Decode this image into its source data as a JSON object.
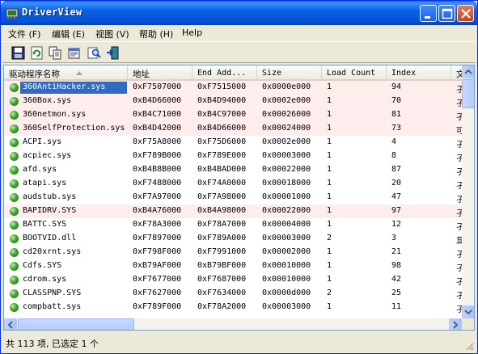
{
  "window": {
    "title": "DriverView"
  },
  "menu": [
    "文件 (F)",
    "编辑 (E)",
    "视图 (V)",
    "帮助 (H)",
    "Help"
  ],
  "toolbar": [
    "save-icon",
    "refresh-icon",
    "copy-icon",
    "properties-icon",
    "search-icon",
    "exit-icon"
  ],
  "columns": [
    "驱动程序名称",
    "地址",
    "End Add...",
    "Size",
    "Load Count",
    "Index",
    "文"
  ],
  "rows": [
    {
      "name": "360AntiHacker.sys",
      "addr": "0xF7507000",
      "end": "0xF7515000",
      "size": "0x0000e000",
      "count": "1",
      "index": "94",
      "extra": "孑",
      "pink": true,
      "selected": true
    },
    {
      "name": "360Box.sys",
      "addr": "0xB4D66000",
      "end": "0xB4D94000",
      "size": "0x0002e000",
      "count": "1",
      "index": "70",
      "extra": "孑",
      "pink": true
    },
    {
      "name": "360netmon.sys",
      "addr": "0xB4C71000",
      "end": "0xB4C97000",
      "size": "0x00026000",
      "count": "1",
      "index": "81",
      "extra": "孑",
      "pink": true
    },
    {
      "name": "360SelfProtection.sys",
      "addr": "0xB4D42000",
      "end": "0xB4D66000",
      "size": "0x00024000",
      "count": "1",
      "index": "73",
      "extra": "可",
      "pink": true
    },
    {
      "name": "ACPI.sys",
      "addr": "0xF75A8000",
      "end": "0xF75D6000",
      "size": "0x0002e000",
      "count": "1",
      "index": "4",
      "extra": "孑"
    },
    {
      "name": "acpiec.sys",
      "addr": "0xF789B000",
      "end": "0xF789E000",
      "size": "0x00003000",
      "count": "1",
      "index": "8",
      "extra": "孑"
    },
    {
      "name": "afd.sys",
      "addr": "0xB4B8B000",
      "end": "0xB4BAD000",
      "size": "0x00022000",
      "count": "1",
      "index": "87",
      "extra": "孑"
    },
    {
      "name": "atapi.sys",
      "addr": "0xF7488000",
      "end": "0xF74A0000",
      "size": "0x00018000",
      "count": "1",
      "index": "20",
      "extra": "孑"
    },
    {
      "name": "audstub.sys",
      "addr": "0xF7A97000",
      "end": "0xF7A98000",
      "size": "0x00001000",
      "count": "1",
      "index": "47",
      "extra": "孑"
    },
    {
      "name": "BAPIDRV.SYS",
      "addr": "0xB4A76000",
      "end": "0xB4A98000",
      "size": "0x00022000",
      "count": "1",
      "index": "97",
      "extra": "孑",
      "pink": true
    },
    {
      "name": "BATTC.SYS",
      "addr": "0xF78A3000",
      "end": "0xF78A7000",
      "size": "0x00004000",
      "count": "1",
      "index": "12",
      "extra": "孑"
    },
    {
      "name": "BOOTVID.dll",
      "addr": "0xF7897000",
      "end": "0xF789A000",
      "size": "0x00003000",
      "count": "2",
      "index": "3",
      "extra": "显"
    },
    {
      "name": "cd20xrnt.sys",
      "addr": "0xF798F000",
      "end": "0xF7991000",
      "size": "0x00002000",
      "count": "1",
      "index": "21",
      "extra": "孑"
    },
    {
      "name": "Cdfs.SYS",
      "addr": "0xB79AF000",
      "end": "0xB79BF000",
      "size": "0x00010000",
      "count": "1",
      "index": "98",
      "extra": "孑"
    },
    {
      "name": "cdrom.sys",
      "addr": "0xF7677000",
      "end": "0xF7687000",
      "size": "0x00010000",
      "count": "1",
      "index": "42",
      "extra": "孑"
    },
    {
      "name": "CLASSPNP.SYS",
      "addr": "0xF7627000",
      "end": "0xF7634000",
      "size": "0x0000d000",
      "count": "2",
      "index": "25",
      "extra": "孑"
    },
    {
      "name": "compbatt.sys",
      "addr": "0xF789F000",
      "end": "0xF78A2000",
      "size": "0x00003000",
      "count": "1",
      "index": "11",
      "extra": "孑"
    }
  ],
  "status": "共 113 项, 已选定 1 个",
  "colors": {
    "selection": "#316ac5",
    "pink_row": "#ffeded",
    "title_bar": "#0b5fe3"
  }
}
